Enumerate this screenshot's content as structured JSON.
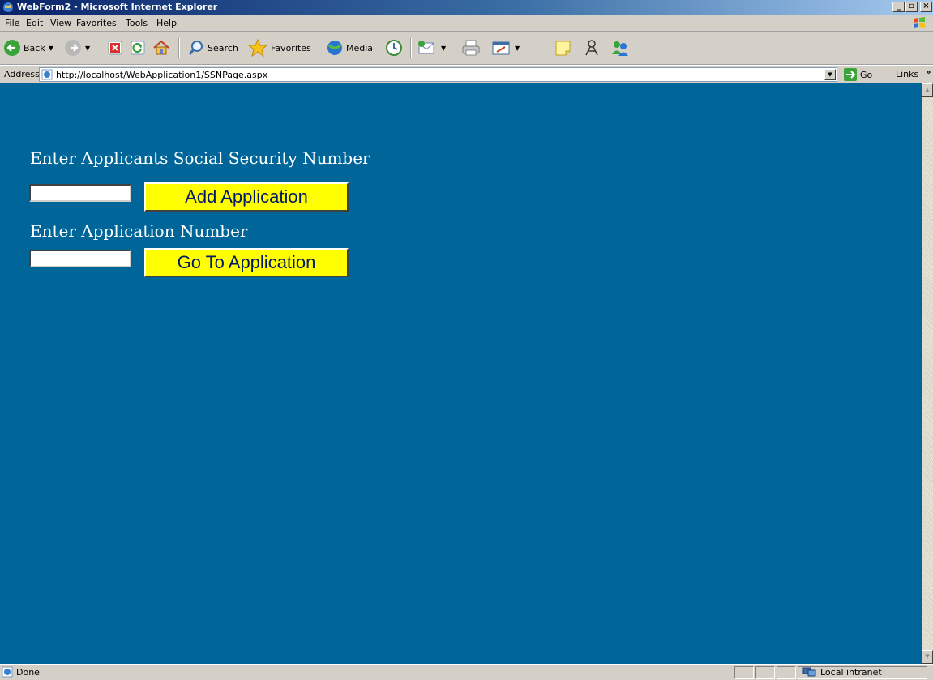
{
  "window": {
    "title": "WebForm2 - Microsoft Internet Explorer"
  },
  "menu": [
    "File",
    "Edit",
    "View",
    "Favorites",
    "Tools",
    "Help"
  ],
  "toolbar": {
    "back_label": "Back",
    "search_label": "Search",
    "favorites_label": "Favorites",
    "media_label": "Media"
  },
  "address": {
    "label": "Address",
    "url": "http://localhost/WebApplication1/SSNPage.aspx",
    "go_label": "Go",
    "links_label": "Links"
  },
  "form": {
    "ssn_heading": "Enter Applicants Social Security Number",
    "ssn_value": "",
    "add_button": "Add Application",
    "app_heading": "Enter Application Number",
    "app_value": "",
    "go_button": "Go To Application"
  },
  "status": {
    "text": "Done",
    "zone": "Local intranet"
  },
  "colors": {
    "page_background": "#006699",
    "button_background": "#ffff00"
  }
}
